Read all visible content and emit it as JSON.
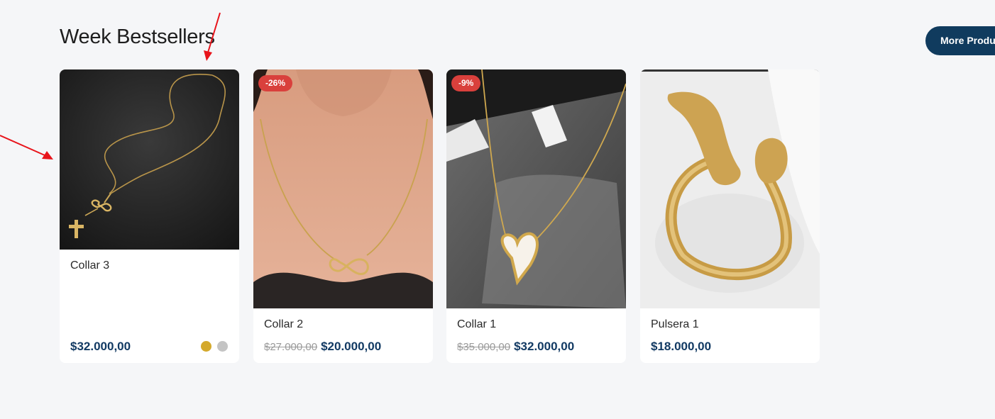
{
  "section": {
    "title": "Week Bestsellers",
    "more_button_label": "More Products"
  },
  "products": [
    {
      "name": "Collar 3",
      "price": "$32.000,00",
      "old_price": "",
      "badge": "",
      "swatches": [
        "#d4a92c",
        "#c4c4c4"
      ]
    },
    {
      "name": "Collar 2",
      "price": "$20.000,00",
      "old_price": "$27.000,00",
      "badge": "-26%"
    },
    {
      "name": "Collar 1",
      "price": "$32.000,00",
      "old_price": "$35.000,00",
      "badge": "-9%"
    },
    {
      "name": "Pulsera 1",
      "price": "$18.000,00",
      "old_price": "",
      "badge": ""
    }
  ],
  "colors": {
    "accent": "#103b5e",
    "price": "#123a63",
    "badge": "#d9403c",
    "annotation_arrow": "#e8141b"
  }
}
